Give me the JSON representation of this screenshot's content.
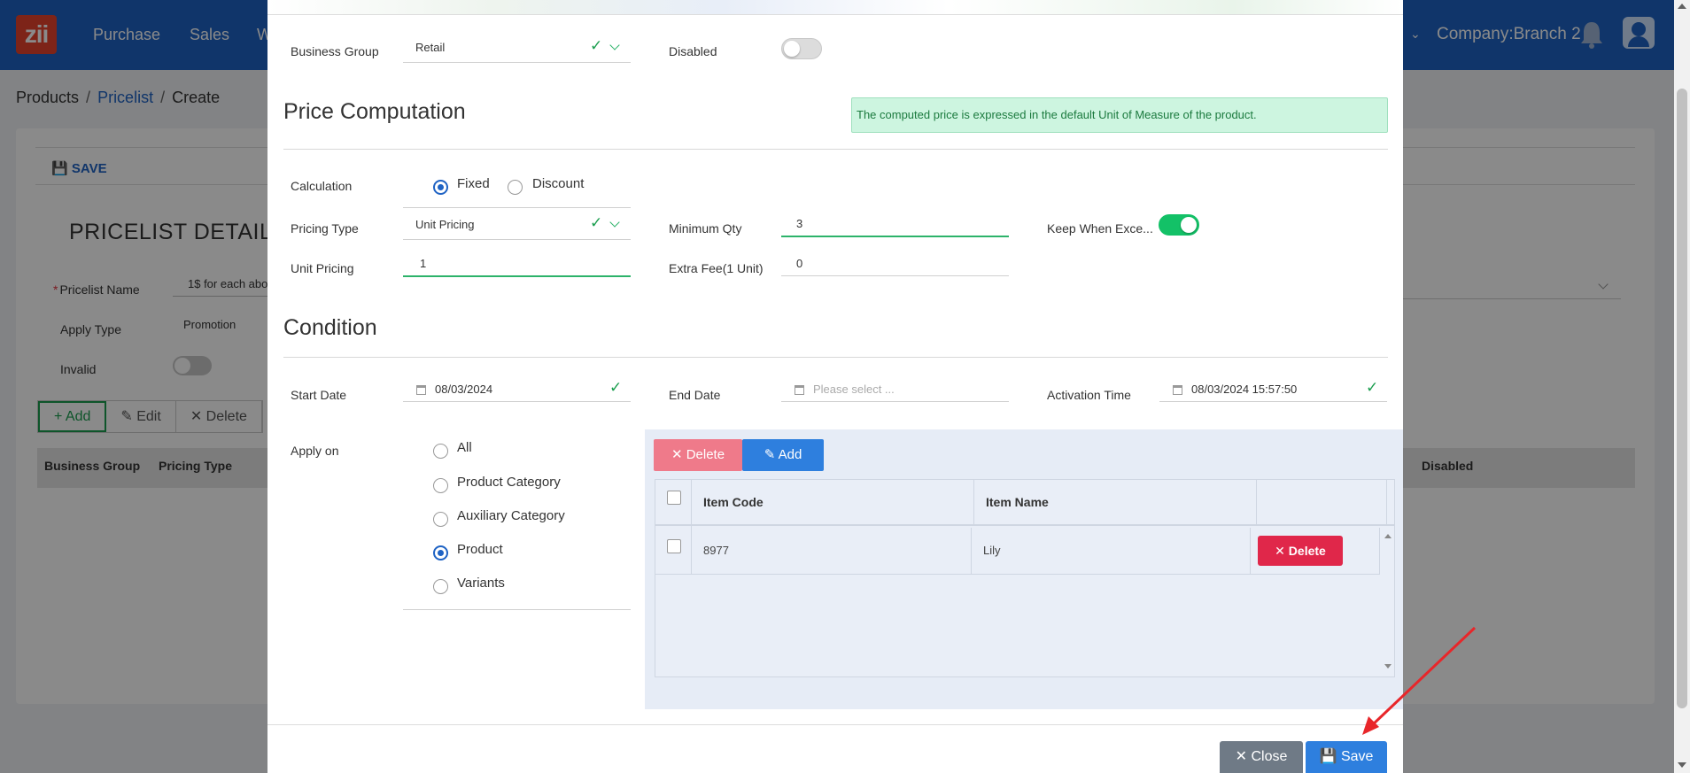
{
  "app": {
    "logo": "zii",
    "nav": [
      "Purchase",
      "Sales",
      "W"
    ],
    "company": "Company:Branch 2"
  },
  "breadcrumb": [
    "Products",
    "Pricelist",
    "Create"
  ],
  "background": {
    "save_label": "SAVE",
    "detail_title": "PRICELIST DETAIL",
    "pricelist_name_label": "Pricelist Name",
    "pricelist_name_value": "1$ for each abo",
    "apply_type_label": "Apply Type",
    "apply_type_value": "Promotion",
    "invalid_label": "Invalid",
    "buttons": {
      "add": "Add",
      "edit": "Edit",
      "delete": "Delete"
    },
    "columns": [
      "Business Group",
      "Pricing Type",
      "Disabled"
    ]
  },
  "modal": {
    "business_group_label": "Business Group",
    "business_group_value": "Retail",
    "disabled_label": "Disabled",
    "disabled_on": false,
    "price_computation_title": "Price Computation",
    "info_text": "The computed price is expressed in the default Unit of Measure of the product.",
    "calculation_label": "Calculation",
    "calculation_options": [
      "Fixed",
      "Discount"
    ],
    "calculation_selected": "Fixed",
    "pricing_type_label": "Pricing Type",
    "pricing_type_value": "Unit Pricing",
    "minimum_qty_label": "Minimum Qty",
    "minimum_qty_value": "3",
    "keep_when_label": "Keep When Exce...",
    "keep_when_on": true,
    "unit_pricing_label": "Unit Pricing",
    "unit_pricing_value": "1",
    "extra_fee_label": "Extra Fee(1 Unit)",
    "extra_fee_value": "0",
    "condition_title": "Condition",
    "start_date_label": "Start Date",
    "start_date_value": "08/03/2024",
    "end_date_label": "End Date",
    "end_date_placeholder": "Please select ...",
    "activation_time_label": "Activation Time",
    "activation_time_value": "08/03/2024 15:57:50",
    "apply_on_label": "Apply on",
    "apply_on_options": [
      "All",
      "Product Category",
      "Auxiliary Category",
      "Product",
      "Variants"
    ],
    "apply_on_selected": "Product",
    "items": {
      "delete_label": "Delete",
      "add_label": "Add",
      "columns": [
        "Item Code",
        "Item Name"
      ],
      "rows": [
        {
          "code": "8977",
          "name": "Lily",
          "action": "Delete"
        }
      ]
    },
    "close_label": "Close",
    "save_label": "Save"
  },
  "colors": {
    "primary": "#1f63c4",
    "success": "#13c167",
    "danger": "#e0274a",
    "info_bg": "#cdf5e0"
  }
}
